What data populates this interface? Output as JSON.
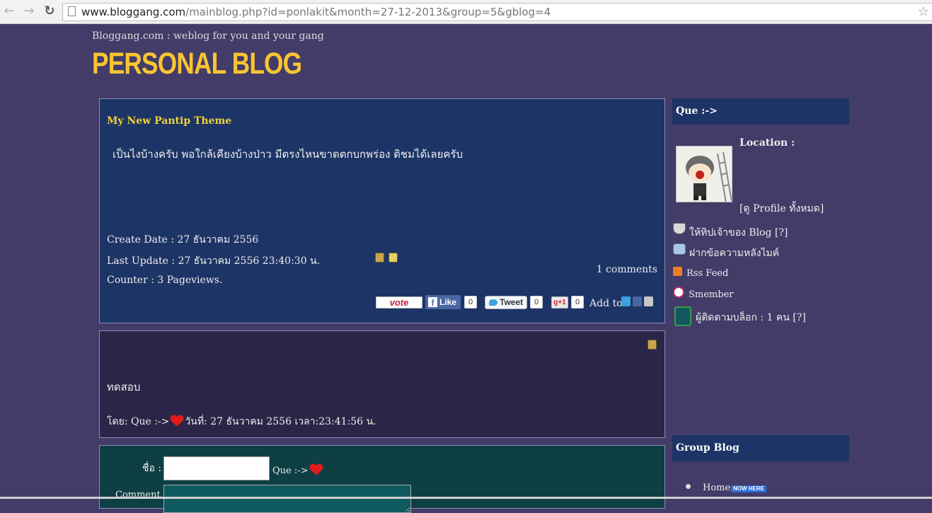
{
  "browser": {
    "url_host": "www.bloggang.com",
    "url_path": "/mainblog.php?id=ponlakit&month=27-12-2013&group=5&gblog=4"
  },
  "header": {
    "tagline": "Bloggang.com : weblog for you and your gang",
    "title": "PERSONAL BLOG"
  },
  "post": {
    "title": "My New Pantip Theme",
    "body": "เป็นไงบ้างครับ พอใกล้เคียงบ้างป่าว มีตรงไหนขาดตกบกพร่อง ติชมได้เลยครับ",
    "create_date": "Create Date : 27 ธันวาคม 2556",
    "last_update": "Last Update : 27 ธันวาคม 2556 23:40:30 น.",
    "counter": "Counter : 3 Pageviews.",
    "comments_count": "1 comments",
    "share": {
      "vote_label": "vote",
      "like_label": "Like",
      "like_count": "0",
      "tweet_label": "Tweet",
      "tweet_count": "0",
      "gplus_label": "g+1",
      "gplus_count": "0",
      "add_to_label": "Add to"
    }
  },
  "comment": {
    "text": "ทดสอบ",
    "by_prefix": "โดย: Que :->",
    "by_suffix": "วันที่: 27 ธันวาคม 2556 เวลา:23:41:56 น."
  },
  "comment_form": {
    "name_label": "ชื่อ :",
    "name_value": "Que :->",
    "comment_label": "Comment :"
  },
  "sidebar": {
    "profile_header": "Que :->",
    "location_label": "Location :",
    "view_profile": "[ดู Profile ทั้งหมด]",
    "links": [
      {
        "label": "ให้ทิปเจ้าของ Blog [?]",
        "icon": "tip-hat-icon"
      },
      {
        "label": "ฝากข้อความหลังไมค์",
        "icon": "message-bubbles-icon"
      },
      {
        "label": "Rss Feed",
        "icon": "rss-icon"
      },
      {
        "label": "Smember",
        "icon": "heart-badge-icon"
      },
      {
        "label": "ผู้ติดตามบล็อก : 1 คน [?]",
        "icon": "follower-icon"
      }
    ],
    "group_header": "Group Blog",
    "group_items": [
      {
        "label": "Home",
        "badge": "NOW HERE"
      }
    ]
  },
  "colors": {
    "page_bg": "#433b68",
    "title_yellow": "#f7c531",
    "post_bg": "#1d3466",
    "comment_bg": "#2b2548",
    "form_bg": "#0e3f44"
  }
}
